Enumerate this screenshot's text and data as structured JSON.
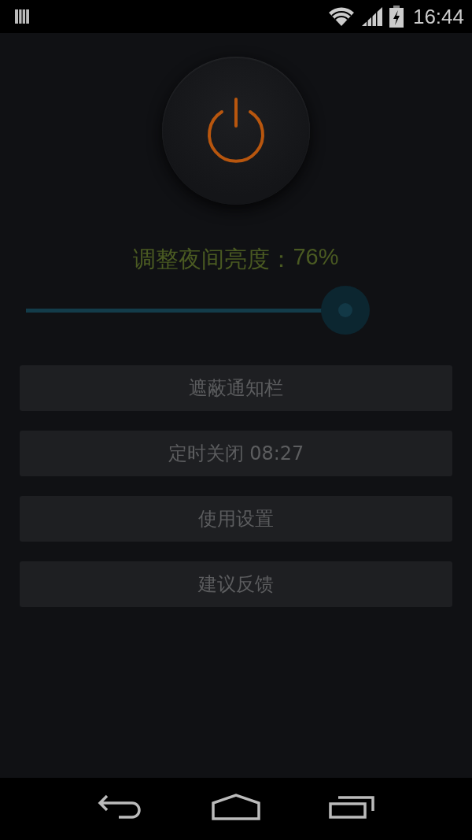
{
  "status_bar": {
    "time": "16:44"
  },
  "power": {
    "on": true
  },
  "brightness": {
    "label": "调整夜间亮度：",
    "reading": "76%",
    "level": 0.76
  },
  "buttons": [
    {
      "label": "遮蔽通知栏"
    },
    {
      "label": "定时关闭 08:27"
    },
    {
      "label": "使用设置"
    },
    {
      "label": "建议反馈"
    }
  ]
}
